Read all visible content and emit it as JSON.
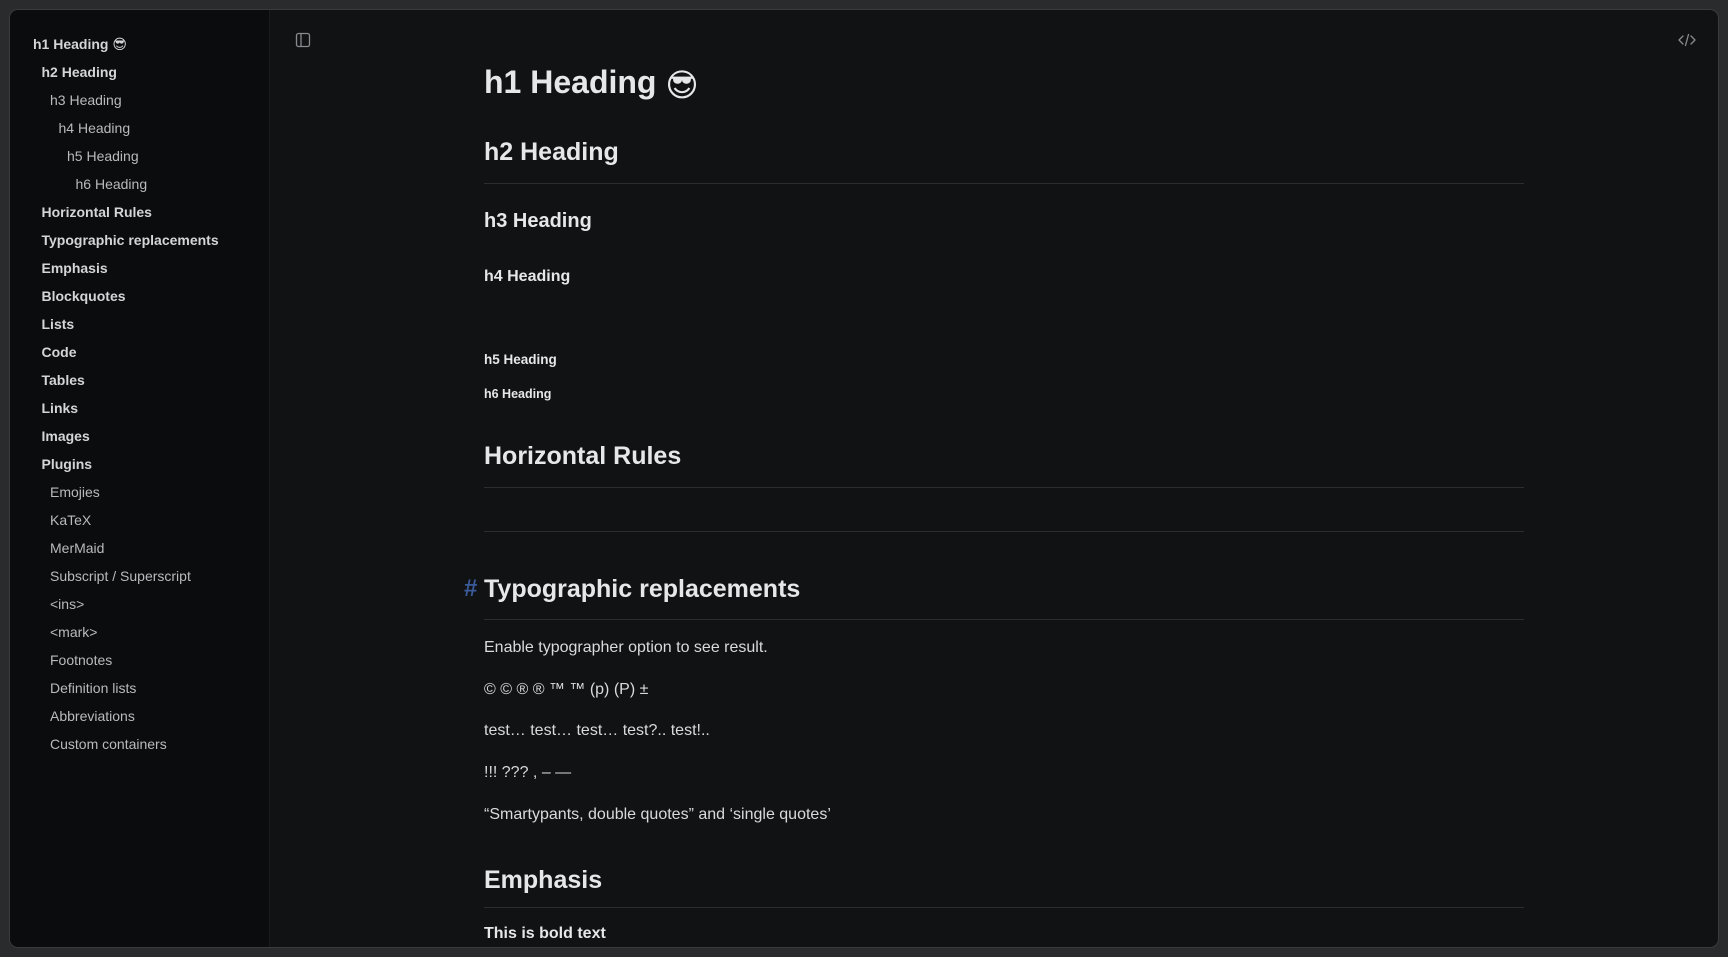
{
  "sidebar": {
    "items": [
      {
        "label": "h1 Heading",
        "emoji": "😎",
        "level": 0,
        "style": "bold"
      },
      {
        "label": "h2 Heading",
        "level": 1,
        "style": "bold"
      },
      {
        "label": "h3 Heading",
        "level": 2,
        "style": "plain"
      },
      {
        "label": "h4 Heading",
        "level": 3,
        "style": "plain"
      },
      {
        "label": "h5 Heading",
        "level": 4,
        "style": "plain"
      },
      {
        "label": "h6 Heading",
        "level": 5,
        "style": "plain"
      },
      {
        "label": "Horizontal Rules",
        "level": 1,
        "style": "bold"
      },
      {
        "label": "Typographic replacements",
        "level": 1,
        "style": "bold"
      },
      {
        "label": "Emphasis",
        "level": 1,
        "style": "bold"
      },
      {
        "label": "Blockquotes",
        "level": 1,
        "style": "bold"
      },
      {
        "label": "Lists",
        "level": 1,
        "style": "bold"
      },
      {
        "label": "Code",
        "level": 1,
        "style": "bold"
      },
      {
        "label": "Tables",
        "level": 1,
        "style": "bold"
      },
      {
        "label": "Links",
        "level": 1,
        "style": "bold"
      },
      {
        "label": "Images",
        "level": 1,
        "style": "bold"
      },
      {
        "label": "Plugins",
        "level": 1,
        "style": "bold"
      },
      {
        "label": "Emojies",
        "level": 2,
        "style": "plain"
      },
      {
        "label": "KaTeX",
        "level": 2,
        "style": "plain"
      },
      {
        "label": "MerMaid",
        "level": 2,
        "style": "plain"
      },
      {
        "label": "Subscript / Superscript",
        "level": 2,
        "style": "plain"
      },
      {
        "label": "<ins>",
        "level": 2,
        "style": "plain"
      },
      {
        "label": "<mark>",
        "level": 2,
        "style": "plain"
      },
      {
        "label": "Footnotes",
        "level": 2,
        "style": "plain"
      },
      {
        "label": "Definition lists",
        "level": 2,
        "style": "plain"
      },
      {
        "label": "Abbreviations",
        "level": 2,
        "style": "plain"
      },
      {
        "label": "Custom containers",
        "level": 2,
        "style": "plain"
      }
    ]
  },
  "toolbar": {
    "sidebar_toggle_icon": "sidebar-toggle-icon",
    "source_icon": "code-icon"
  },
  "document": {
    "h1": "h1 Heading",
    "h1_emoji": "😎",
    "h2": "h2 Heading",
    "h3": "h3 Heading",
    "h4": "h4 Heading",
    "h5": "h5 Heading",
    "h6": "h6 Heading",
    "hr_heading": "Horizontal Rules",
    "typo_anchor": "#",
    "typo_heading": "Typographic replacements",
    "typo_p1": "Enable typographer option to see result.",
    "typo_p2": "© © ® ® ™ ™ (p) (P) ±",
    "typo_p3": "test… test… test… test?.. test!..",
    "typo_p4": "!!! ??? , – —",
    "typo_p5": "“Smartypants, double quotes” and ‘single quotes’",
    "emphasis_heading": "Emphasis",
    "bold_text": "This is bold text"
  },
  "colors": {
    "background": "#111214",
    "sidebar_bg": "#0b0c0e",
    "text": "#e6e7e9",
    "anchor": "#3b5a9a"
  }
}
